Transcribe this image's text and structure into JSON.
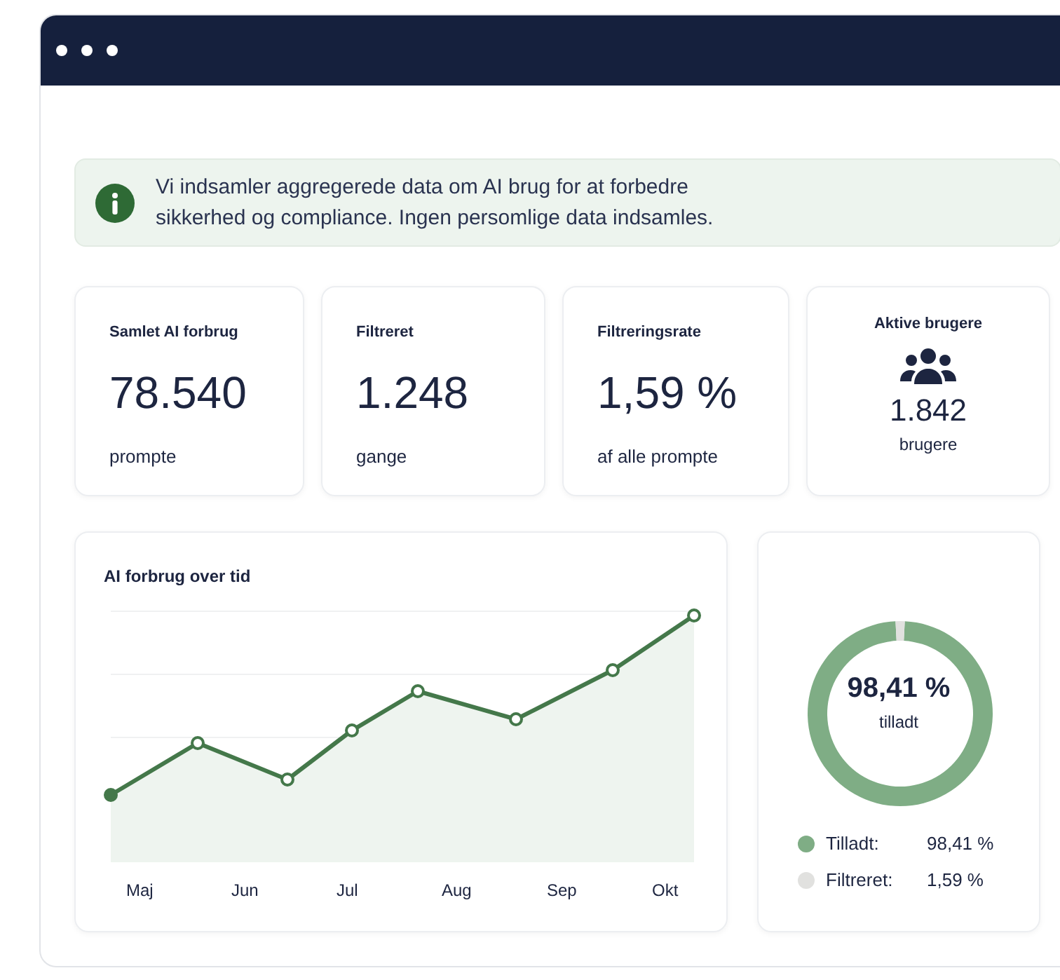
{
  "notice": {
    "text": "Vi indsamler aggregerede data om AI brug for at forbedre sikkerhed og compliance. Ingen persomlige data indsamles."
  },
  "stats": [
    {
      "kind": "number",
      "label": "Samlet AI forbrug",
      "value": "78.540",
      "unit": "prompte"
    },
    {
      "kind": "number",
      "label": "Filtreret",
      "value": "1.248",
      "unit": "gange"
    },
    {
      "kind": "number",
      "label": "Filtreringsrate",
      "value": "1,59 %",
      "unit": "af alle prompte"
    },
    {
      "kind": "users",
      "label": "Aktive brugere",
      "value": "1.842",
      "unit": "brugere"
    }
  ],
  "usage_chart": {
    "title": "AI forbrug over tid",
    "x_labels": [
      "Maj",
      "Jun",
      "Jul",
      "Aug",
      "Sep",
      "Okt"
    ]
  },
  "allowed_chart": {
    "center_value": "98,41 %",
    "center_label": "tilladt",
    "chart_data": {
      "type": "donut",
      "categories": [
        "Tilladt",
        "Filtreret"
      ],
      "values": [
        98.41,
        1.59
      ]
    },
    "legend": [
      {
        "separator": ":",
        "value": "98,41 %",
        "color": "#7fad85"
      },
      {
        "separator": ":",
        "value": "1,59 %",
        "color": "#e1e1df"
      }
    ]
  }
}
